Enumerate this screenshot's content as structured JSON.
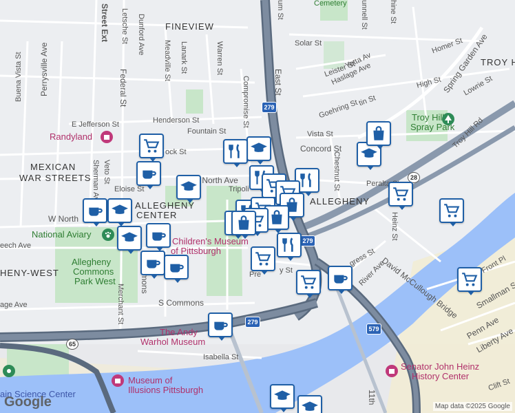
{
  "map": {
    "neighborhoods": [
      "FINEVIEW",
      "MEXICAN",
      "WAR STREETS",
      "ALLEGHENY",
      "CENTER",
      "TROY HI",
      "HENY-WEST",
      "ALLEGHENY"
    ],
    "streets": {
      "street_ext": "Street Ext",
      "letsche": "Letsche St",
      "dunford": "Dunford Ave",
      "perrysville": "Perrysville Ave",
      "buena_vista": "Buena Vista St",
      "federal": "Federal St",
      "meadville": "Meadville St",
      "lanark": "Lanark St",
      "warren": "Warren St",
      "compromise": "Compromise St",
      "east": "East St",
      "e_jefferson": "E Jefferson St",
      "henderson": "Henderson St",
      "fountain": "Fountain St",
      "lock": "ock St",
      "e_north": "E North Ave",
      "tripoli": "Tripoli",
      "eloise": "Eloise St",
      "veto": "Veto St",
      "sherman": "Sherman Av",
      "w_north": "W North",
      "beech": "eech Ave",
      "commons": "Commons",
      "merchant": "Merchant St",
      "s_commons": "S Commons",
      "age_ave": "age Ave",
      "isabella": "Isabella St",
      "vista": "Vista St",
      "concord": "Concord St",
      "chestnut": "Chestnut St",
      "peralta": "Peralta St",
      "heinz": "Heinz St",
      "david_mccullough": "David McCullough Bridge",
      "river_ave": "River Ave",
      "gress": "gress St",
      "pre": "Pre",
      "y_st": "y St",
      "smallman": "Smallman St",
      "penn": "Penn Ave",
      "liberty": "Liberty Ave",
      "front": "Front Pl",
      "clift": "Clift St",
      "eleventh": "11th",
      "leister": "Leister St",
      "yetta": "Yetta Av",
      "haslage": "Haslage Ave",
      "solar": "Solar St",
      "high": "High St",
      "homer": "Homer St",
      "spring_garden": "Spring Garden Ave",
      "lowrie": "Lowrie St",
      "goehring": "Goehring St",
      "tin": "tin St",
      "troy_hill_rd": "Troy Hill Rd",
      "cemetery": "Cemetery",
      "um": "um St",
      "unnell": "unnell St",
      "hine": "hine St"
    },
    "pois": {
      "randyland": "Randyland",
      "national_aviary": "National Aviary",
      "allegheny_commons_park_west_1": "Allegheny",
      "allegheny_commons_park_west_2": "Commons",
      "allegheny_commons_park_west_3": "Park West",
      "childrens_museum_1": "Children's Museum",
      "childrens_museum_2": "of Pittsburgh",
      "warhol_1": "The Andy",
      "warhol_2": "Warhol Museum",
      "museum_illusions_1": "Museum of",
      "museum_illusions_2": "Illusions Pittsburgh",
      "science_center": "ain Science Center",
      "heinz_history_1": "Senator John Heinz",
      "heinz_history_2": "History Center",
      "troy_hill_spray_1": "Troy Hill",
      "troy_hill_spray_2": "Spray Park"
    },
    "shields": {
      "i279_a": "279",
      "i279_b": "279",
      "i279_c": "279",
      "i579": "579",
      "r28": "28",
      "r65": "65"
    },
    "attribution": "Map data ©2025 Google",
    "logo": "Google",
    "colors": {
      "water": "#9cc0f9",
      "park": "#c8e6c9",
      "highway": "#5a6a7e",
      "road": "#ffffff",
      "marker_border": "#1f5fa6",
      "pink": "#b0306a"
    }
  }
}
